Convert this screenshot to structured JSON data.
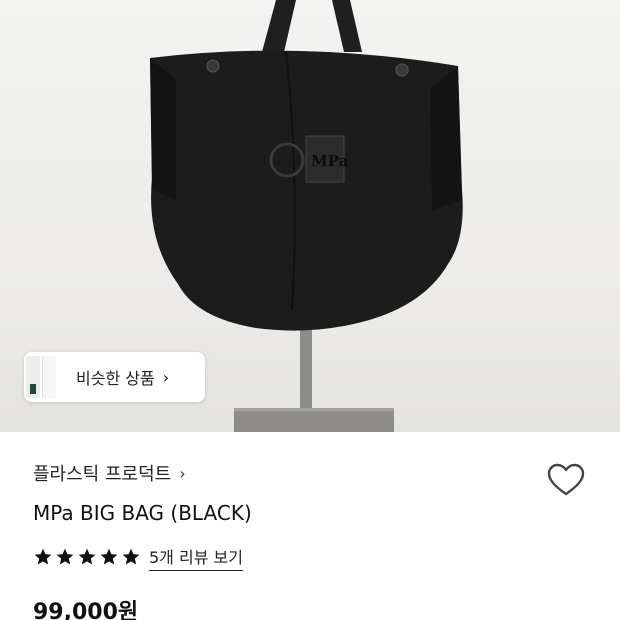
{
  "similar": {
    "label": "비슷한 상품",
    "chevron": "›"
  },
  "product": {
    "brand": "플라스틱 프로덕트",
    "brand_chevron": "›",
    "title": "MPa BIG BAG (BLACK)",
    "rating_stars": 5,
    "review_link": "5개 리뷰 보기",
    "price": "99,000원",
    "bag_logo_text": "MPa"
  },
  "icons": {
    "wishlist": "heart-outline-icon",
    "star": "star-filled-icon",
    "chevron": "chevron-right-icon"
  },
  "colors": {
    "bag": "#1c1c1d",
    "star": "#111111",
    "background": "#ffffff"
  }
}
